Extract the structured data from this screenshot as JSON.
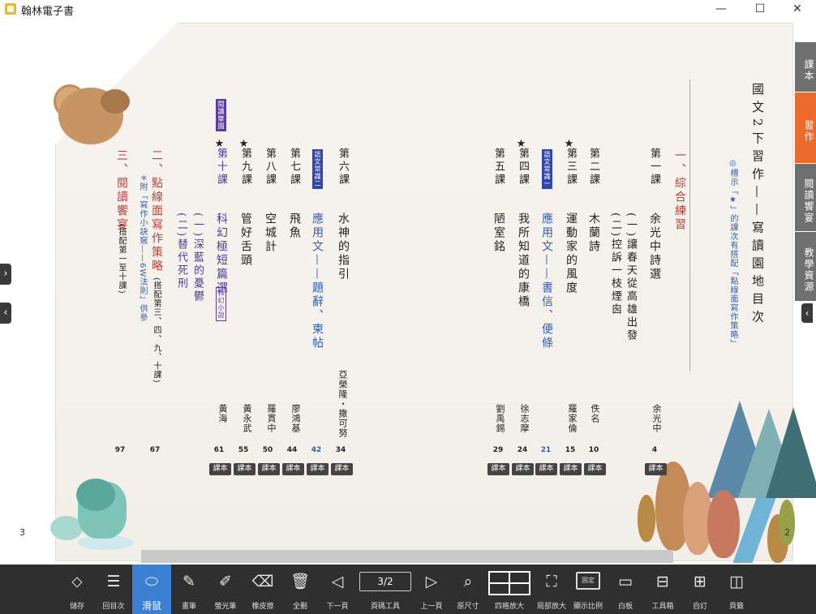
{
  "window": {
    "title": "翰林電子書",
    "minimize": "—",
    "maximize": "☐",
    "close": "✕"
  },
  "side_arrows": {
    "right": "›",
    "left": "‹"
  },
  "pages": {
    "left": "3",
    "right": "2"
  },
  "toc": {
    "title": "國文2下習作——寫讀園地目次",
    "note": "◎標示「★」的課次有搭配「點線面寫作策略」",
    "section1": "一、綜合練習",
    "items": [
      {
        "lesson": "第一課",
        "star": "",
        "title": "余光中詩選",
        "sub": [
          "(一)讓春天從高雄出發",
          "(二)控訴一枝煙囪"
        ],
        "author": "余光中",
        "page": "4"
      },
      {
        "lesson": "第二課",
        "star": "",
        "title": "木蘭詩",
        "author": "佚名",
        "page": "10"
      },
      {
        "lesson": "第三課",
        "star": "★",
        "title": "運動家的風度",
        "author": "羅家倫",
        "page": "15"
      },
      {
        "tag": "語文常識一",
        "title": "應用文——書信、便條",
        "page": "21"
      },
      {
        "lesson": "第四課",
        "star": "★",
        "title": "我所知道的康橋",
        "author": "徐志摩",
        "page": "24"
      },
      {
        "lesson": "第五課",
        "star": "",
        "title": "陋室銘",
        "author": "劉禹錫",
        "page": "29"
      },
      {
        "lesson": "第六課",
        "star": "",
        "title": "水神的指引",
        "author": "亞榮隆・撒可努",
        "page": "34"
      },
      {
        "tag": "語文常識二",
        "title": "應用文——題辭、柬帖",
        "page": "42"
      },
      {
        "lesson": "第七課",
        "star": "",
        "title": "飛魚",
        "author": "廖鴻基",
        "page": "44"
      },
      {
        "lesson": "第八課",
        "star": "",
        "title": "空城計",
        "author": "羅貫中",
        "page": "50"
      },
      {
        "lesson": "第九課",
        "star": "★",
        "title": "管好舌頭",
        "author": "黃永武",
        "page": "55"
      },
      {
        "lesson": "第十課",
        "star": "★",
        "tag": "閱讀樂園",
        "title": "科幻極短篇選",
        "box": "科幻小說",
        "sub": [
          "(一)深藍的憂鬱",
          "(二)替代死刑"
        ],
        "author": "黃海",
        "page": "61"
      }
    ],
    "section2": "二、點線面寫作策略",
    "section2_note": "(搭配第三、四、九、十課)",
    "section2_sub": "＊附「寫作小訣竅——6W法則」供參",
    "section2_page": "67",
    "section3": "三、閱讀饗宴",
    "section3_note": "(搭配第一至十課)",
    "section3_page": "97",
    "chip_label": "課本"
  },
  "right_tabs": [
    "課本",
    "習作",
    "閱讀饗宴",
    "教學資源"
  ],
  "toolbar": {
    "save": "儲存",
    "back_toc": "回目次",
    "mouse": "滑鼠",
    "pen": "畫筆",
    "highlighter": "螢光筆",
    "eraser": "橡皮擦",
    "clear": "全刪",
    "next": "下一頁",
    "page_tool": "頁碼工具",
    "page_value": "3/2",
    "prev": "上一頁",
    "original": "原尺寸",
    "quad": "四格放大",
    "zoom_local": "局部放大",
    "ratio": "顯示比例",
    "fixed": "固定",
    "whiteboard": "白板",
    "toolbox": "工具箱",
    "custom": "自訂",
    "pagination": "頁籤"
  },
  "colors": {
    "accent": "#3a7fd1",
    "tab_active": "#ec6a2c",
    "tab": "#6f6f6f",
    "toolbar": "#2f2f2f"
  }
}
